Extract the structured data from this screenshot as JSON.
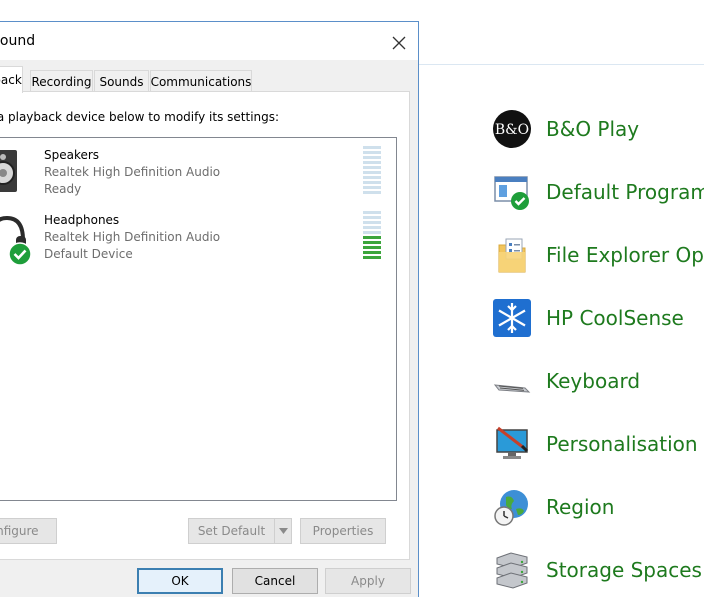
{
  "dialog": {
    "title": "Sound",
    "tabs": [
      {
        "label": "Playback"
      },
      {
        "label": "Recording"
      },
      {
        "label": "Sounds"
      },
      {
        "label": "Communications"
      }
    ],
    "instruction": "Select a playback device below to modify its settings:",
    "devices": [
      {
        "name": "Speakers",
        "driver": "Realtek High Definition Audio",
        "status": "Ready",
        "icon": "speaker-icon",
        "level": 0.0
      },
      {
        "name": "Headphones",
        "driver": "Realtek High Definition Audio",
        "status": "Default Device",
        "icon": "headphones-icon",
        "default_badge": "check-icon",
        "level": 0.5
      }
    ],
    "buttons": {
      "configure": "Configure",
      "set_default": "Set Default",
      "properties": "Properties",
      "ok": "OK",
      "cancel": "Cancel",
      "apply": "Apply"
    }
  },
  "control_panel": {
    "items": [
      {
        "label": "B&O Play",
        "icon": "bo-play-icon"
      },
      {
        "label": "Default Programs",
        "icon": "default-programs-icon"
      },
      {
        "label": "File Explorer Options",
        "icon": "folder-options-icon"
      },
      {
        "label": "HP CoolSense",
        "icon": "snowflake-icon"
      },
      {
        "label": "Keyboard",
        "icon": "keyboard-icon"
      },
      {
        "label": "Personalisation",
        "icon": "monitor-brush-icon"
      },
      {
        "label": "Region",
        "icon": "globe-clock-icon"
      },
      {
        "label": "Storage Spaces",
        "icon": "storage-drives-icon"
      }
    ]
  },
  "colors": {
    "link_green": "#1e7a1e",
    "dialog_border": "#5b8fc9",
    "meter_active": "#3ca53c",
    "meter_idle": "#cfe0ec",
    "check_green": "#1e9e3a"
  }
}
